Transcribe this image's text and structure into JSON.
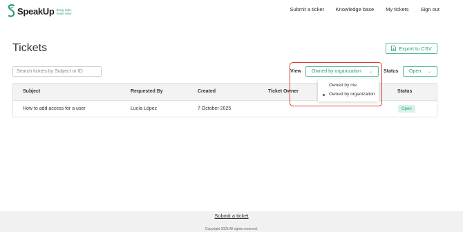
{
  "brand": {
    "name": "SpeakUp",
    "tagline": "doing right, made easy",
    "accent": "#2a9d78"
  },
  "nav": {
    "submit": "Submit a ticket",
    "knowledge": "Knowledge base",
    "my_tickets": "My tickets",
    "sign_out": "Sign out"
  },
  "page": {
    "title": "Tickets",
    "export_label": "Export to CSV"
  },
  "filters": {
    "search_placeholder": "Search tickets by Subject or ID",
    "view_label": "View",
    "view_value": "Owned by organization",
    "status_label": "Status",
    "status_value": "Open",
    "view_options": [
      "Owned by me",
      "Owned by organization"
    ]
  },
  "table": {
    "columns": [
      "Subject",
      "Requested By",
      "Created",
      "Ticket Owner",
      "Status"
    ],
    "rows": [
      {
        "subject": "How to add access for a user",
        "requested_by": "Lucía López",
        "created": "7 October 2025",
        "owner": "",
        "status": "Open"
      }
    ]
  },
  "footer": {
    "link": "Submit a ticket",
    "copyright": "Copyright 2025 All rights reserved."
  },
  "colors": {
    "highlight": "#d93b30",
    "badge_bg": "#d7f3e6"
  }
}
